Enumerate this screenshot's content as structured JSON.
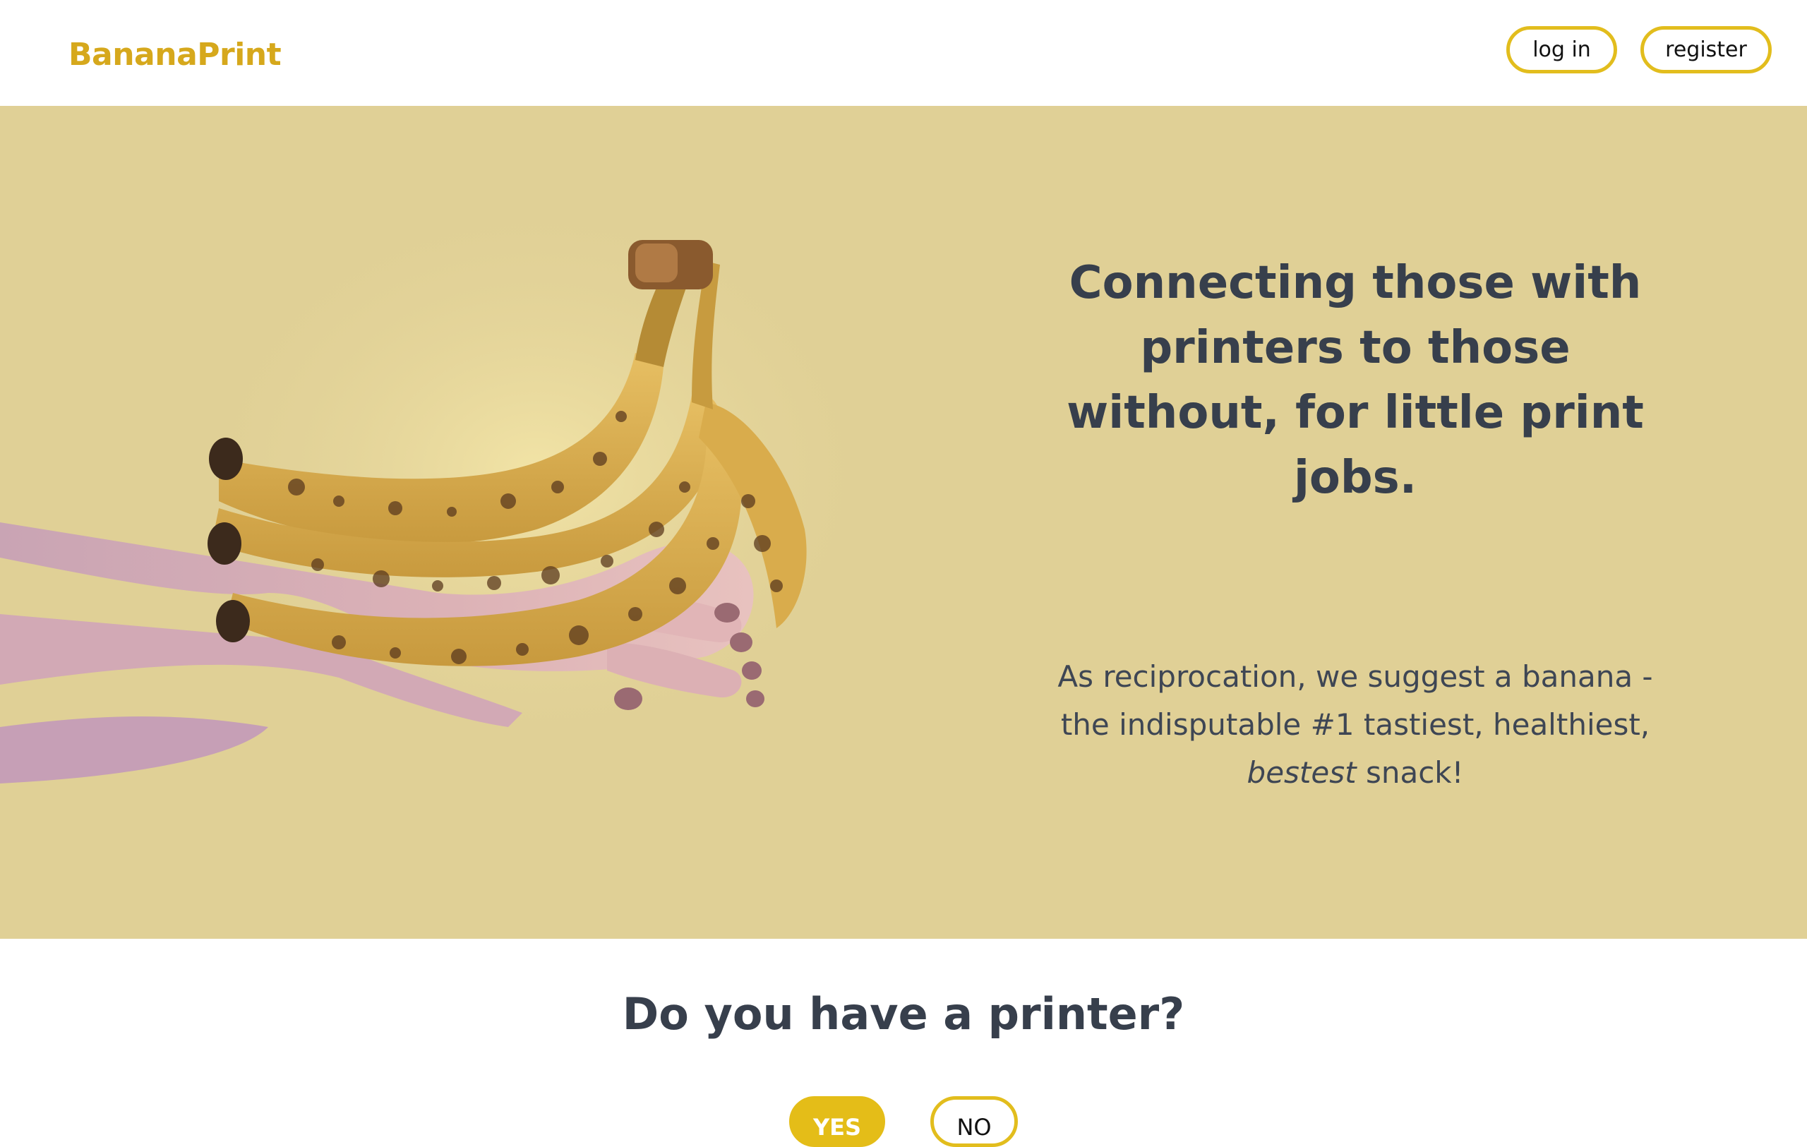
{
  "header": {
    "brand": "BananaPrint",
    "login_label": "log in",
    "register_label": "register"
  },
  "hero": {
    "headline": "Connecting those with printers to those without, for little print jobs.",
    "subtext_main": "As reciprocation, we suggest a banana - the indisputable #1 tastiest, healthiest,",
    "subtext_emphasis": "bestest",
    "subtext_end": "snack!",
    "image_description": "hand holding a bunch of ripe bananas"
  },
  "printer_question": {
    "title": "Do you have a printer?",
    "yes_label": "YES",
    "no_label": "NO"
  },
  "colors": {
    "brand": "#d6a81c",
    "accent": "#e4bd18",
    "hero_background": "#e0d096",
    "text": "#373f4c"
  }
}
